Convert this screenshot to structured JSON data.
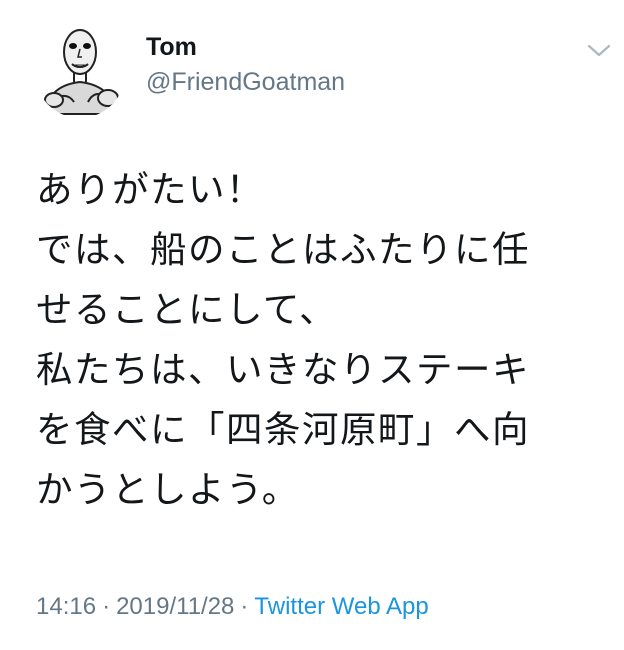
{
  "author": {
    "display_name": "Tom",
    "handle": "@FriendGoatman"
  },
  "icons": {
    "avatar": "bald-man-avatar",
    "more": "chevron-down-icon"
  },
  "tweet": {
    "lines": [
      "ありがたい！",
      "では、船のことはふたりに任",
      "せることにして、",
      "私たちは、いきなりステーキ",
      "を食べに「四条河原町」へ向",
      "かうとしよう。"
    ]
  },
  "meta": {
    "time": "14:16",
    "separator": "·",
    "date": "2019/11/28",
    "source": "Twitter Web App"
  },
  "colors": {
    "text": "#14171a",
    "secondary": "#657786",
    "link": "#1b95e0",
    "background": "#ffffff"
  }
}
